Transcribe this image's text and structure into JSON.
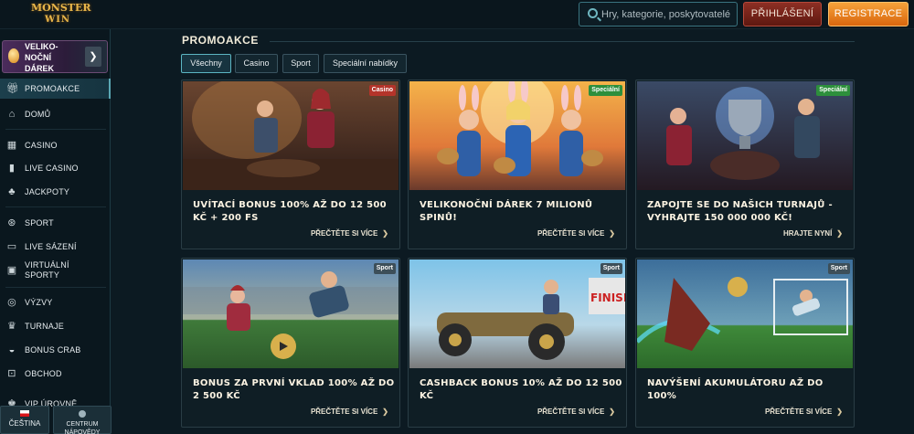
{
  "header": {
    "logo_line1": "MONSTER",
    "logo_line2": "WIN",
    "search_placeholder": "Hry, kategorie, poskytovatelé",
    "login_label": "PŘIHLÁŠENÍ",
    "register_label": "REGISTRACE"
  },
  "sidebar": {
    "easter_banner": "VELIKO-NOČNÍ DÁREK",
    "items": [
      {
        "label": "PROMOAKCE",
        "icon": "gift-icon"
      },
      {
        "label": "DOMŮ",
        "icon": "home-icon"
      },
      {
        "label": "CASINO",
        "icon": "slot-icon"
      },
      {
        "label": "LIVE CASINO",
        "icon": "cards-icon"
      },
      {
        "label": "JACKPOTY",
        "icon": "clover-icon"
      },
      {
        "label": "SPORT",
        "icon": "ball-icon"
      },
      {
        "label": "LIVE SÁZENÍ",
        "icon": "live-icon"
      },
      {
        "label": "VIRTUÁLNÍ SPORTY",
        "icon": "virtual-icon"
      },
      {
        "label": "VÝZVY",
        "icon": "target-icon"
      },
      {
        "label": "TURNAJE",
        "icon": "trophy-icon"
      },
      {
        "label": "BONUS CRAB",
        "icon": "crab-icon"
      },
      {
        "label": "OBCHOD",
        "icon": "bag-icon"
      },
      {
        "label": "VIP ÚROVNĚ",
        "icon": "crown-icon"
      }
    ],
    "language_label": "ČEŠTINA",
    "help_label": "CENTRUM NÁPOVĚDY"
  },
  "main": {
    "title": "PROMOAKCE",
    "tabs": [
      "Všechny",
      "Casino",
      "Sport",
      "Speciální nabídky"
    ],
    "cards": [
      {
        "badge": "Casino",
        "title": "UVÍTACÍ BONUS 100% AŽ DO 12 500 KČ + 200 FS",
        "cta": "PŘEČTĚTE SI VÍCE"
      },
      {
        "badge": "Speciální",
        "title": "VELIKONOČNÍ DÁREK 7 MILIONŮ SPINŮ!",
        "cta": "PŘEČTĚTE SI VÍCE"
      },
      {
        "badge": "Speciální",
        "title": "ZAPOJTE SE DO NAŠICH TURNAJŮ - VYHRAJTE 150 000 000 KČ!",
        "cta": "HRAJTE NYNÍ"
      },
      {
        "badge": "Sport",
        "title": "BONUS ZA PRVNÍ VKLAD 100% AŽ DO 2 500 KČ",
        "cta": "PŘEČTĚTE SI VÍCE"
      },
      {
        "badge": "Sport",
        "title": "CASHBACK BONUS 10% AŽ DO 12 500 KČ",
        "cta": "PŘEČTĚTE SI VÍCE"
      },
      {
        "badge": "Sport",
        "title": "NAVÝŠENÍ AKUMULÁTORU AŽ DO 100%",
        "cta": "PŘEČTĚTE SI VÍCE"
      }
    ]
  },
  "colors": {
    "accent": "#5cb6c3",
    "badge_casino": "#b4342a",
    "badge_special": "#2d8f3c",
    "badge_sport": "#3d4f59",
    "register": "#f08a25",
    "login": "#8d2f24"
  }
}
